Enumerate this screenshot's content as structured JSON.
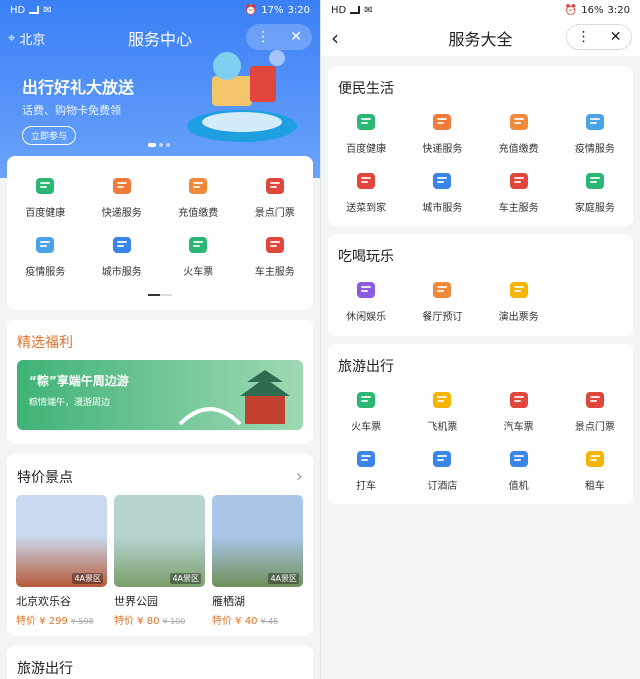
{
  "left": {
    "status": {
      "left": "HD",
      "time": "3:20",
      "battery": "17%"
    },
    "nav": {
      "location": "北京",
      "title": "服务中心",
      "menu": "⋮",
      "close": "✕"
    },
    "banner": {
      "headline": "出行好礼大放送",
      "sub": "话费、购物卡免费领",
      "button": "立即参与"
    },
    "services": [
      {
        "label": "百度健康",
        "icon": "health-icon",
        "color": "#2bb673"
      },
      {
        "label": "快递服务",
        "icon": "cart-icon",
        "color": "#f07a3a"
      },
      {
        "label": "充值缴费",
        "icon": "recharge-icon",
        "color": "#f08a3a"
      },
      {
        "label": "景点门票",
        "icon": "temple-icon",
        "color": "#e0463c"
      },
      {
        "label": "疫情服务",
        "icon": "mask-icon",
        "color": "#4aa3e6"
      },
      {
        "label": "城市服务",
        "icon": "building-icon",
        "color": "#3a86e6"
      },
      {
        "label": "火车票",
        "icon": "train-icon",
        "color": "#2bb673"
      },
      {
        "label": "车主服务",
        "icon": "car-icon",
        "color": "#e0463c"
      }
    ],
    "welfare": {
      "title": "精选福利",
      "promo_title": "“粽”享端午周边游",
      "promo_sub": "粽情端午，漫游周边"
    },
    "spots": {
      "title": "特价景点",
      "arrow": "›",
      "items": [
        {
          "name": "北京欢乐谷",
          "level": "4A景区",
          "price": "特价 ¥ 299",
          "orig": "¥ 598",
          "c1": "#c9d9ef",
          "c2": "#b85a3a"
        },
        {
          "name": "世界公园",
          "level": "4A景区",
          "price": "特价 ¥ 80",
          "orig": "¥ 100",
          "c1": "#b7d3d0",
          "c2": "#7a9f6a"
        },
        {
          "name": "雁栖湖",
          "level": "4A景区",
          "price": "特价 ¥ 40",
          "orig": "¥ 45",
          "c1": "#a9c6e8",
          "c2": "#6f8f5a"
        }
      ]
    },
    "travel": {
      "title": "旅游出行"
    }
  },
  "right": {
    "status": {
      "left": "HD",
      "time": "3:20",
      "battery": "16%"
    },
    "nav": {
      "back": "‹",
      "title": "服务大全",
      "menu": "⋮",
      "close": "✕"
    },
    "sections": [
      {
        "title": "便民生活",
        "items": [
          {
            "label": "百度健康",
            "icon": "health-icon",
            "color": "#2bb673"
          },
          {
            "label": "快递服务",
            "icon": "cart-icon",
            "color": "#f07a3a"
          },
          {
            "label": "充值缴费",
            "icon": "recharge-icon",
            "color": "#f08a3a"
          },
          {
            "label": "疫情服务",
            "icon": "mask-icon",
            "color": "#4aa3e6"
          },
          {
            "label": "送菜到家",
            "icon": "tomato-icon",
            "color": "#e0463c"
          },
          {
            "label": "城市服务",
            "icon": "building-icon",
            "color": "#3a86e6"
          },
          {
            "label": "车主服务",
            "icon": "car-icon",
            "color": "#e0463c"
          },
          {
            "label": "家庭服务",
            "icon": "home-icon",
            "color": "#2bb673"
          }
        ]
      },
      {
        "title": "吃喝玩乐",
        "items": [
          {
            "label": "休闲娱乐",
            "icon": "mic-icon",
            "color": "#8a5ce0"
          },
          {
            "label": "餐厅预订",
            "icon": "dining-icon",
            "color": "#f08a3a"
          },
          {
            "label": "演出票务",
            "icon": "ticket-icon",
            "color": "#f5b400"
          }
        ]
      },
      {
        "title": "旅游出行",
        "items": [
          {
            "label": "火车票",
            "icon": "train-icon",
            "color": "#2bb673"
          },
          {
            "label": "飞机票",
            "icon": "plane-icon",
            "color": "#f5b400"
          },
          {
            "label": "汽车票",
            "icon": "bus-icon",
            "color": "#e0463c"
          },
          {
            "label": "景点门票",
            "icon": "temple-icon",
            "color": "#e0463c"
          },
          {
            "label": "打车",
            "icon": "taxi-icon",
            "color": "#3a86e6"
          },
          {
            "label": "订酒店",
            "icon": "hotel-icon",
            "color": "#3a86e6"
          },
          {
            "label": "值机",
            "icon": "checkin-icon",
            "color": "#3a86e6"
          },
          {
            "label": "租车",
            "icon": "rental-icon",
            "color": "#f5b400"
          }
        ]
      }
    ]
  }
}
